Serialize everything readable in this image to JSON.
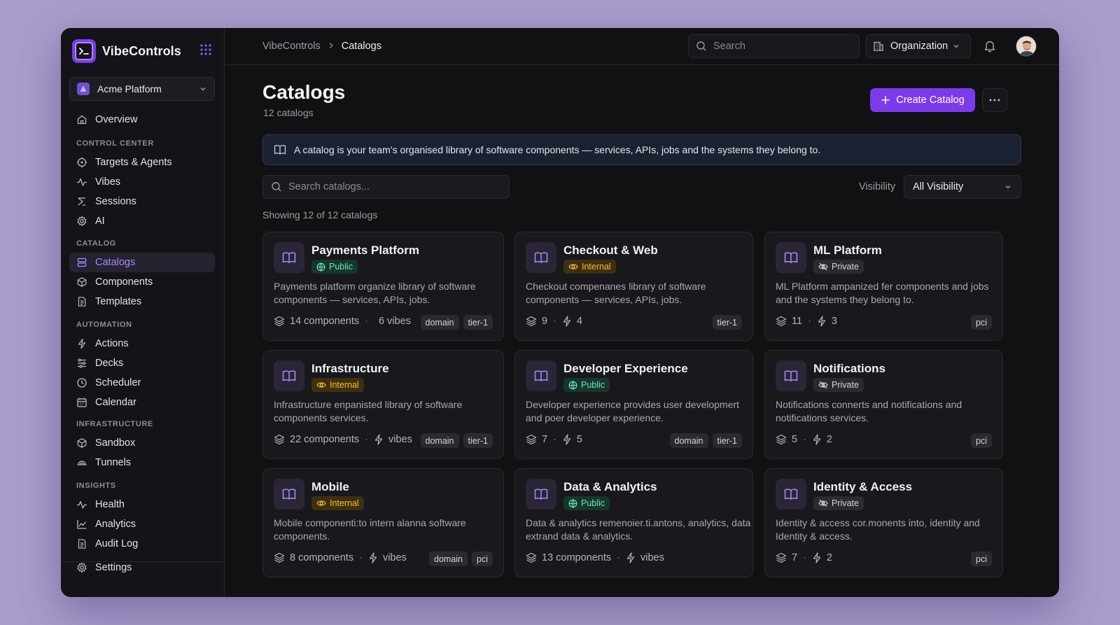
{
  "brand": {
    "name": "VibeControls"
  },
  "org_selector": {
    "label": "Acme Platform"
  },
  "sidebar": {
    "overview": "Overview",
    "sections": {
      "control_center": "CONTROL CENTER",
      "catalog": "CATALOG",
      "automation": "AUTOMATION",
      "infrastructure": "INFRASTRUCTURE",
      "insights": "INSIGHTS"
    },
    "items": {
      "targets_agents": "Targets & Agents",
      "vibes": "Vibes",
      "sessions": "Sessions",
      "ai": "AI",
      "catalogs": "Catalogs",
      "components": "Components",
      "templates": "Templates",
      "actions": "Actions",
      "decks": "Decks",
      "scheduler": "Scheduler",
      "calendar": "Calendar",
      "sandbox": "Sandbox",
      "tunnels": "Tunnels",
      "health": "Health",
      "analytics": "Analytics",
      "audit_log": "Audit Log",
      "settings": "Settings"
    }
  },
  "topbar": {
    "breadcrumb": [
      "VibeControls",
      "Catalogs"
    ],
    "search_placeholder": "Search",
    "org_button": "Organization"
  },
  "page": {
    "title": "Catalogs",
    "subtitle": "12 catalogs",
    "create_button": "Create Catalog",
    "banner": "A catalog is your team’s organised library of software components — services, APIs, jobs and the systems they belong to.",
    "search_placeholder": "Search catalogs...",
    "visibility_label": "Visibility",
    "visibility_value": "All Visibility",
    "showing": "Showing 12 of 12 catalogs"
  },
  "colors": {
    "accent": "#7c3aed",
    "public": "#6ee7b7",
    "internal": "#fbbf24",
    "private": "#d4d4da"
  },
  "cards": [
    {
      "title": "Payments Platform",
      "badge": "Public",
      "badge_type": "public",
      "desc": "Payments platform organize library of software components — services, APIs, jobs.",
      "m1": "14 components",
      "m2": "6 vibes",
      "tags": [
        "domain",
        "tier-1"
      ]
    },
    {
      "title": "Checkout & Web",
      "badge": "Internal",
      "badge_type": "internal",
      "desc": "Checkout compenanes library of software components — services, APIs, jobs.",
      "m1": "9",
      "m2": "4",
      "tags": [
        "tier-1"
      ]
    },
    {
      "title": "ML Platform",
      "badge": "Private",
      "badge_type": "private",
      "desc": "ML Platform ampanized fer components and jobs and the systems they belong to.",
      "m1": "11",
      "m2": "3",
      "tags": [
        "pci"
      ]
    },
    {
      "title": "Infrastructure",
      "badge": "Internal",
      "badge_type": "internal",
      "desc": "Infrastructure enpanisted library of software components services.",
      "m1": "22 components",
      "m2": "vibes",
      "tags": [
        "domain",
        "tier-1"
      ]
    },
    {
      "title": "Developer Experience",
      "badge": "Public",
      "badge_type": "public",
      "desc": "Developer experience provides user developmert and poer developer experience.",
      "m1": "7",
      "m2": "5",
      "tags": [
        "domain",
        "tier-1"
      ]
    },
    {
      "title": "Notifications",
      "badge": "Private",
      "badge_type": "private",
      "desc": "Notifications connerts and notifications and notifications services.",
      "m1": "5",
      "m2": "2",
      "tags": [
        "pci"
      ]
    },
    {
      "title": "Mobile",
      "badge": "Internal",
      "badge_type": "internal",
      "desc": "Mobile componenti:to intern alanna software components.",
      "m1": "8 components",
      "m2": "vibes",
      "tags": [
        "domain",
        "pci"
      ]
    },
    {
      "title": "Data & Analytics",
      "badge": "Public",
      "badge_type": "public",
      "desc": "Data & analytics remenoier.ti.antons, analytics, data extrand data & analytics.",
      "m1": "13 components",
      "m2": "vibes",
      "tags": []
    },
    {
      "title": "Identity & Access",
      "badge": "Private",
      "badge_type": "private",
      "desc": "Identity & access cor.monents into, identity and Identity & access.",
      "m1": "7",
      "m2": "2",
      "tags": [
        "pci"
      ]
    }
  ]
}
